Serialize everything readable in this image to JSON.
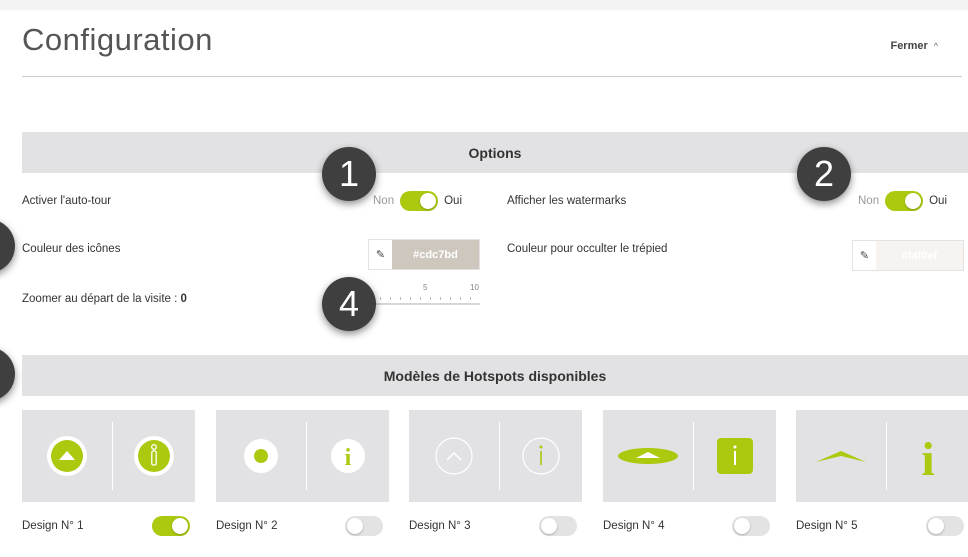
{
  "header": {
    "title": "Configuration",
    "close_label": "Fermer",
    "close_icon": "chevron-up-icon"
  },
  "options": {
    "section_title": "Options",
    "autotour": {
      "label": "Activer l'auto-tour",
      "off_label": "Non",
      "on_label": "Oui",
      "enabled": true
    },
    "watermarks": {
      "label": "Afficher les watermarks",
      "off_label": "Non",
      "on_label": "Oui",
      "enabled": true
    },
    "icon_color": {
      "label": "Couleur des icônes",
      "value": "#cdc7bd",
      "swatch": "#cdc7bd"
    },
    "tripod_color": {
      "label": "Couleur pour occulter le trépied",
      "value": "#f4f0ef",
      "swatch": "#f7f3f1"
    },
    "zoom": {
      "label": "Zoomer au départ de la visite :",
      "value": "0",
      "tick_labels": [
        "5",
        "10"
      ]
    }
  },
  "hotspots": {
    "section_title": "Modèles de Hotspots disponibles",
    "designs": [
      {
        "label": "Design N° 1",
        "enabled": true
      },
      {
        "label": "Design N° 2",
        "enabled": false
      },
      {
        "label": "Design N° 3",
        "enabled": false
      },
      {
        "label": "Design N° 4",
        "enabled": false
      },
      {
        "label": "Design N° 5",
        "enabled": false
      }
    ]
  },
  "badges": [
    "1",
    "2",
    "4"
  ],
  "colors": {
    "accent": "#acc90f",
    "section_bg": "#e2e2e4",
    "badge_bg": "#3f3f3f"
  }
}
